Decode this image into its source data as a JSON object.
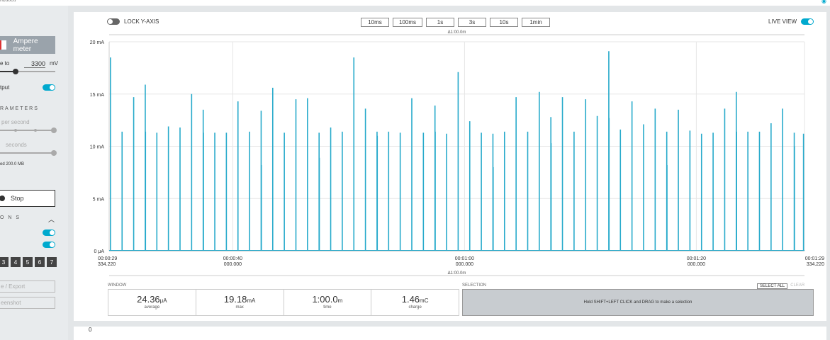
{
  "top": {
    "device_text": "hbs8cu"
  },
  "sidebar": {
    "mode_label": "Ampere meter",
    "supply_label": "e to",
    "supply_value": "3300",
    "supply_unit": "mV",
    "output_label": "tput",
    "params_heading": "RAMETERS",
    "rate_label": "per second",
    "duration_label": "seconds",
    "storage_text": "ed 200.0 MB",
    "stop_label": "Stop",
    "options_heading": "O N S",
    "digits": [
      "3",
      "4",
      "5",
      "6",
      "7"
    ],
    "export_label": "e / Export",
    "screenshot_label": "eenshot"
  },
  "toolbar": {
    "lock_label": "LOCK Y-AXIS",
    "windows": [
      "10ms",
      "100ms",
      "1s",
      "3s",
      "10s",
      "1min"
    ],
    "live_label": "LIVE VIEW"
  },
  "chart_data": {
    "type": "line",
    "title": "",
    "xlabel": "",
    "ylabel": "",
    "span_label": "Δ1:00.0m",
    "y_ticks": [
      "20 mA",
      "15 mA",
      "10 mA",
      "5 mA",
      "0 μA"
    ],
    "x_ticks": [
      {
        "l1": "00:00:29",
        "l2": "334.220"
      },
      {
        "l1": "00:00:40",
        "l2": "000.000"
      },
      {
        "l1": "00:01:00",
        "l2": "000.000"
      },
      {
        "l1": "00:01:20",
        "l2": "000.000"
      },
      {
        "l1": "00:01:29",
        "l2": "334.220"
      }
    ],
    "ylim": [
      0,
      20
    ],
    "xlim_seconds": [
      29.33422,
      89.33422
    ],
    "series": [
      {
        "color": "#27aacb",
        "unit": "mA",
        "spikes": [
          {
            "t": 29.45,
            "mA": 18.5
          },
          {
            "t": 30.45,
            "mA": 11.4
          },
          {
            "t": 31.45,
            "mA": 14.7
          },
          {
            "t": 32.45,
            "mA": 15.9
          },
          {
            "t": 32.47,
            "mA": 11.4
          },
          {
            "t": 33.45,
            "mA": 11.3
          },
          {
            "t": 34.45,
            "mA": 11.9
          },
          {
            "t": 35.45,
            "mA": 11.8
          },
          {
            "t": 36.45,
            "mA": 15.0
          },
          {
            "t": 37.45,
            "mA": 13.5
          },
          {
            "t": 37.47,
            "mA": 11.3
          },
          {
            "t": 38.45,
            "mA": 11.3
          },
          {
            "t": 39.45,
            "mA": 11.3
          },
          {
            "t": 40.45,
            "mA": 14.3
          },
          {
            "t": 41.45,
            "mA": 11.4
          },
          {
            "t": 42.45,
            "mA": 13.4
          },
          {
            "t": 42.47,
            "mA": 8.2
          },
          {
            "t": 43.45,
            "mA": 15.6
          },
          {
            "t": 44.45,
            "mA": 11.3
          },
          {
            "t": 45.45,
            "mA": 14.5
          },
          {
            "t": 46.45,
            "mA": 14.6
          },
          {
            "t": 47.45,
            "mA": 11.3
          },
          {
            "t": 47.47,
            "mA": 8.9
          },
          {
            "t": 48.45,
            "mA": 11.8
          },
          {
            "t": 49.45,
            "mA": 11.4
          },
          {
            "t": 50.45,
            "mA": 18.5
          },
          {
            "t": 51.45,
            "mA": 13.6
          },
          {
            "t": 52.45,
            "mA": 11.4
          },
          {
            "t": 52.47,
            "mA": 11.0
          },
          {
            "t": 53.45,
            "mA": 11.4
          },
          {
            "t": 54.45,
            "mA": 11.3
          },
          {
            "t": 55.45,
            "mA": 14.6
          },
          {
            "t": 56.45,
            "mA": 11.3
          },
          {
            "t": 57.45,
            "mA": 13.9
          },
          {
            "t": 57.47,
            "mA": 11.4
          },
          {
            "t": 58.45,
            "mA": 11.2
          },
          {
            "t": 59.45,
            "mA": 17.1
          },
          {
            "t": 60.45,
            "mA": 12.4
          },
          {
            "t": 61.45,
            "mA": 11.3
          },
          {
            "t": 62.45,
            "mA": 11.2
          },
          {
            "t": 62.47,
            "mA": 8.0
          },
          {
            "t": 63.45,
            "mA": 11.4
          },
          {
            "t": 64.45,
            "mA": 14.7
          },
          {
            "t": 65.45,
            "mA": 11.4
          },
          {
            "t": 66.45,
            "mA": 15.2
          },
          {
            "t": 67.45,
            "mA": 12.8
          },
          {
            "t": 67.47,
            "mA": 10.3
          },
          {
            "t": 68.45,
            "mA": 14.7
          },
          {
            "t": 69.45,
            "mA": 11.4
          },
          {
            "t": 70.45,
            "mA": 14.5
          },
          {
            "t": 71.45,
            "mA": 12.9
          },
          {
            "t": 72.45,
            "mA": 19.1
          },
          {
            "t": 72.47,
            "mA": 12.7
          },
          {
            "t": 73.45,
            "mA": 11.6
          },
          {
            "t": 74.45,
            "mA": 14.3
          },
          {
            "t": 75.45,
            "mA": 12.1
          },
          {
            "t": 76.45,
            "mA": 13.6
          },
          {
            "t": 77.45,
            "mA": 11.4
          },
          {
            "t": 77.47,
            "mA": 8.2
          },
          {
            "t": 78.45,
            "mA": 13.5
          },
          {
            "t": 79.45,
            "mA": 11.5
          },
          {
            "t": 80.45,
            "mA": 11.2
          },
          {
            "t": 81.45,
            "mA": 11.3
          },
          {
            "t": 82.45,
            "mA": 13.6
          },
          {
            "t": 83.45,
            "mA": 15.2
          },
          {
            "t": 83.47,
            "mA": 11.4
          },
          {
            "t": 84.45,
            "mA": 11.4
          },
          {
            "t": 85.45,
            "mA": 11.4
          },
          {
            "t": 86.45,
            "mA": 12.2
          },
          {
            "t": 87.45,
            "mA": 13.6
          },
          {
            "t": 88.45,
            "mA": 11.3
          },
          {
            "t": 88.47,
            "mA": 10.0
          },
          {
            "t": 89.25,
            "mA": 11.2
          }
        ]
      }
    ]
  },
  "window_stats": {
    "label": "WINDOW",
    "items": [
      {
        "value": "24.36",
        "unit": "μA",
        "label": "average"
      },
      {
        "value": "19.18",
        "unit": "mA",
        "label": "max"
      },
      {
        "value": "1:00.0",
        "unit": "m",
        "label": "time"
      },
      {
        "value": "1.46",
        "unit": "mC",
        "label": "charge"
      }
    ]
  },
  "selection": {
    "label": "SELECTION",
    "select_all": "SELECT ALL",
    "clear": "CLEAR",
    "hint": "Hold SHIFT+LEFT CLICK and DRAG to make a selection"
  },
  "bottom": {
    "value": "0"
  }
}
